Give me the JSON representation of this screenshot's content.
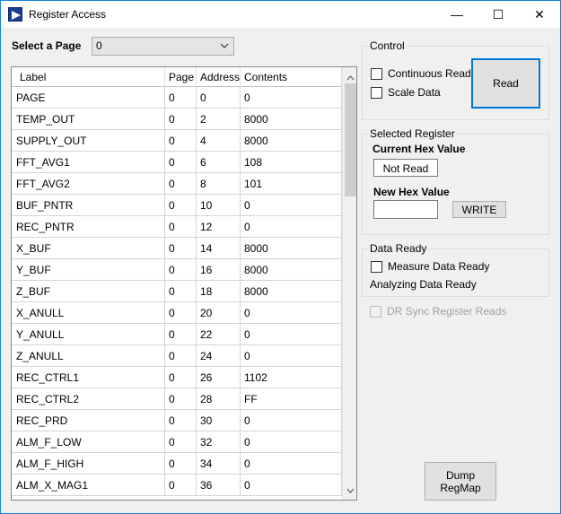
{
  "window": {
    "title": "Register Access",
    "controls": {
      "minimize": "—",
      "maximize": "☐",
      "close": "✕"
    },
    "accent_color": "#1883d7"
  },
  "page_selector": {
    "label": "Select a Page",
    "value": "0"
  },
  "grid": {
    "columns": [
      "Label",
      "Page",
      "Address",
      "Contents"
    ],
    "rows": [
      [
        "PAGE",
        "0",
        "0",
        "0"
      ],
      [
        "TEMP_OUT",
        "0",
        "2",
        "8000"
      ],
      [
        "SUPPLY_OUT",
        "0",
        "4",
        "8000"
      ],
      [
        "FFT_AVG1",
        "0",
        "6",
        "108"
      ],
      [
        "FFT_AVG2",
        "0",
        "8",
        "101"
      ],
      [
        "BUF_PNTR",
        "0",
        "10",
        "0"
      ],
      [
        "REC_PNTR",
        "0",
        "12",
        "0"
      ],
      [
        "X_BUF",
        "0",
        "14",
        "8000"
      ],
      [
        "Y_BUF",
        "0",
        "16",
        "8000"
      ],
      [
        "Z_BUF",
        "0",
        "18",
        "8000"
      ],
      [
        "X_ANULL",
        "0",
        "20",
        "0"
      ],
      [
        "Y_ANULL",
        "0",
        "22",
        "0"
      ],
      [
        "Z_ANULL",
        "0",
        "24",
        "0"
      ],
      [
        "REC_CTRL1",
        "0",
        "26",
        "1102"
      ],
      [
        "REC_CTRL2",
        "0",
        "28",
        "FF"
      ],
      [
        "REC_PRD",
        "0",
        "30",
        "0"
      ],
      [
        "ALM_F_LOW",
        "0",
        "32",
        "0"
      ],
      [
        "ALM_F_HIGH",
        "0",
        "34",
        "0"
      ],
      [
        "ALM_X_MAG1",
        "0",
        "36",
        "0"
      ]
    ]
  },
  "control": {
    "title": "Control",
    "continuous_reads": "Continuous Reads",
    "scale_data": "Scale Data",
    "read_button": "Read"
  },
  "selected_register": {
    "title": "Selected Register",
    "current_hex_label": "Current Hex Value",
    "current_hex_value": "Not Read",
    "new_hex_label": "New Hex Value",
    "new_hex_value": "",
    "write_button": "WRITE"
  },
  "data_ready": {
    "title": "Data Ready",
    "measure": "Measure Data Ready",
    "analyzing": "Analyzing Data Ready"
  },
  "dr_sync": "DR Sync Register Reads",
  "dump_button_line1": "Dump",
  "dump_button_line2": "RegMap"
}
